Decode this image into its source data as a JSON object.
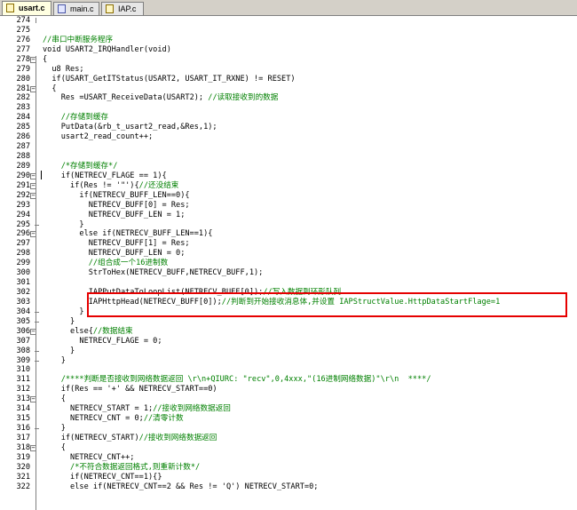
{
  "tabs": [
    {
      "label": "usart.c",
      "active": true,
      "icon": "c-file-icon"
    },
    {
      "label": "main.c",
      "active": false,
      "icon": "c-file-icon"
    },
    {
      "label": "IAP.c",
      "active": false,
      "icon": "c-file-icon"
    }
  ],
  "highlight_color": "#e60000",
  "comment_color": "#008000",
  "lines": [
    {
      "num": "274",
      "text": ""
    },
    {
      "num": "275",
      "text": ""
    },
    {
      "num": "276",
      "text": "//串口中断服务程序"
    },
    {
      "num": "277",
      "text": "void USART2_IRQHandler(void)"
    },
    {
      "num": "278",
      "text": "{"
    },
    {
      "num": "279",
      "text": "  u8 Res;"
    },
    {
      "num": "280",
      "text": "  if(USART_GetITStatus(USART2, USART_IT_RXNE) != RESET)"
    },
    {
      "num": "281",
      "text": "  {"
    },
    {
      "num": "282",
      "text": "    Res =USART_ReceiveData(USART2); //读取接收到的数据"
    },
    {
      "num": "283",
      "text": ""
    },
    {
      "num": "284",
      "text": "    //存储到缓存"
    },
    {
      "num": "285",
      "text": "    PutData(&rb_t_usart2_read,&Res,1);"
    },
    {
      "num": "286",
      "text": "    usart2_read_count++;"
    },
    {
      "num": "287",
      "text": ""
    },
    {
      "num": "288",
      "text": ""
    },
    {
      "num": "289",
      "text": "    /*存储到缓存*/"
    },
    {
      "num": "290",
      "text": "    if(NETRECV_FLAGE == 1){"
    },
    {
      "num": "291",
      "text": "      if(Res != '\"'){//还没结束"
    },
    {
      "num": "292",
      "text": "        if(NETRECV_BUFF_LEN==0){"
    },
    {
      "num": "293",
      "text": "          NETRECV_BUFF[0] = Res;"
    },
    {
      "num": "294",
      "text": "          NETRECV_BUFF_LEN = 1;"
    },
    {
      "num": "295",
      "text": "        }"
    },
    {
      "num": "296",
      "text": "        else if(NETRECV_BUFF_LEN==1){"
    },
    {
      "num": "297",
      "text": "          NETRECV_BUFF[1] = Res;"
    },
    {
      "num": "298",
      "text": "          NETRECV_BUFF_LEN = 0;"
    },
    {
      "num": "299",
      "text": "          //组合成一个16进制数"
    },
    {
      "num": "300",
      "text": "          StrToHex(NETRECV_BUFF,NETRECV_BUFF,1);"
    },
    {
      "num": "301",
      "text": ""
    },
    {
      "num": "302",
      "text": "          IAPPutDataToLoopList(NETRECV_BUFF[0]);//写入数据到环形队列"
    },
    {
      "num": "303",
      "text": "          IAPHttpHead(NETRECV_BUFF[0]);//判断到开始接收消息体,并设置 IAPStructValue.HttpDataStartFlage=1"
    },
    {
      "num": "304",
      "text": "        }"
    },
    {
      "num": "305",
      "text": "      }"
    },
    {
      "num": "306",
      "text": "      else{//数据结束"
    },
    {
      "num": "307",
      "text": "        NETRECV_FLAGE = 0;"
    },
    {
      "num": "308",
      "text": "      }"
    },
    {
      "num": "309",
      "text": "    }"
    },
    {
      "num": "310",
      "text": ""
    },
    {
      "num": "311",
      "text": "    /****判断是否接收到网络数据返回 \\r\\n+QIURC: \"recv\",0,4xxx,\"(16进制网络数据)\"\\r\\n  ****/"
    },
    {
      "num": "312",
      "text": "    if(Res == '+' && NETRECV_START==0)"
    },
    {
      "num": "313",
      "text": "    {"
    },
    {
      "num": "314",
      "text": "      NETRECV_START = 1;//接收到网络数据返回"
    },
    {
      "num": "315",
      "text": "      NETRECV_CNT = 0;//清零计数"
    },
    {
      "num": "316",
      "text": "    }"
    },
    {
      "num": "317",
      "text": "    if(NETRECV_START)//接收到网络数据返回"
    },
    {
      "num": "318",
      "text": "    {"
    },
    {
      "num": "319",
      "text": "      NETRECV_CNT++;"
    },
    {
      "num": "320",
      "text": "      /*不符合数据返回格式,则重新计数*/"
    },
    {
      "num": "321",
      "text": "      if(NETRECV_CNT==1){}"
    },
    {
      "num": "322",
      "text": "      else if(NETRECV_CNT==2 && Res != 'Q') NETRECV_START=0;"
    }
  ]
}
